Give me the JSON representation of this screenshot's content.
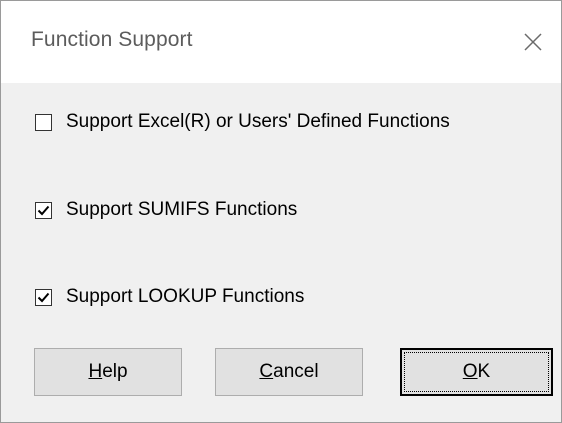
{
  "dialog": {
    "title": "Function Support",
    "close_icon": "close-icon"
  },
  "options": [
    {
      "label": "Support Excel(R) or Users' Defined Functions",
      "checked": false
    },
    {
      "label": "Support SUMIFS Functions",
      "checked": true
    },
    {
      "label": "Support LOOKUP Functions",
      "checked": true
    }
  ],
  "buttons": {
    "help": {
      "mnemonic": "H",
      "rest": "elp"
    },
    "cancel": {
      "mnemonic": "C",
      "rest": "ancel"
    },
    "ok": {
      "mnemonic": "O",
      "rest": "K"
    }
  }
}
